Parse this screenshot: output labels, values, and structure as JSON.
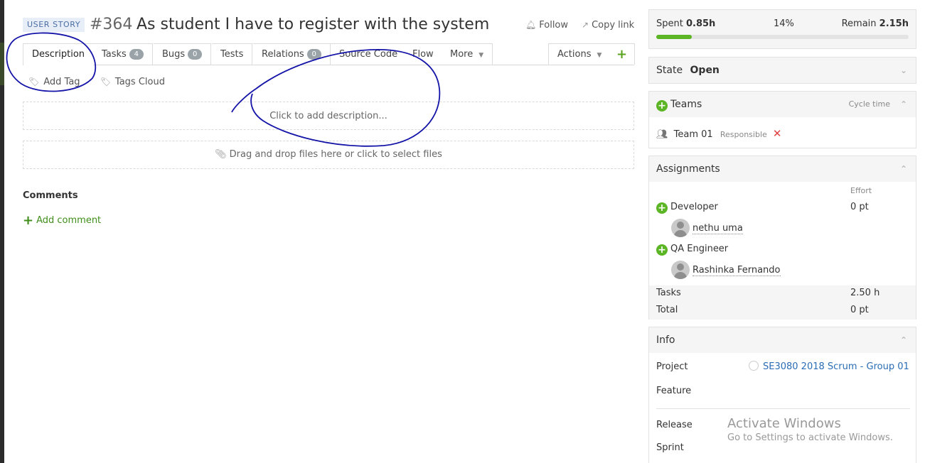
{
  "header": {
    "badge": "USER STORY",
    "id": "#364",
    "title": "As student I have to register with the system",
    "follow": "Follow",
    "copy_link": "Copy link"
  },
  "tabs": {
    "description": "Description",
    "tasks": "Tasks",
    "tasks_count": "4",
    "bugs": "Bugs",
    "bugs_count": "0",
    "tests": "Tests",
    "relations": "Relations",
    "relations_count": "0",
    "source_code": "Source Code",
    "flow": "Flow",
    "more": "More",
    "actions": "Actions",
    "add": "+"
  },
  "tags": {
    "add_tag": "Add Tag",
    "tags_cloud": "Tags Cloud"
  },
  "description_placeholder": "Click to add description...",
  "files_placeholder": "Drag and drop files here or click to select files",
  "comments": {
    "heading": "Comments",
    "add": "Add comment"
  },
  "progress": {
    "spent_label": "Spent",
    "spent_value": "0.85h",
    "percent_text": "14%",
    "percent": 0.14,
    "remain_label": "Remain",
    "remain_value": "2.15h"
  },
  "state": {
    "label": "State",
    "value": "Open"
  },
  "teams": {
    "title": "Teams",
    "cycle_time": "Cycle time",
    "team_name": "Team 01",
    "team_role": "Responsible"
  },
  "assignments": {
    "title": "Assignments",
    "effort_header": "Effort",
    "developer_role": "Developer",
    "developer_effort": "0 pt",
    "developer_user": "nethu uma",
    "qa_role": "QA Engineer",
    "qa_user": "Rashinka Fernando",
    "tasks_label": "Tasks",
    "tasks_value": "2.50 h",
    "total_label": "Total",
    "total_value": "0 pt"
  },
  "info": {
    "title": "Info",
    "project_label": "Project",
    "project_value": "SE3080 2018 Scrum - Group 01",
    "feature_label": "Feature",
    "release_label": "Release",
    "sprint_label": "Sprint"
  },
  "watermark": {
    "line1": "Activate Windows",
    "line2": "Go to Settings to activate Windows."
  },
  "colors": {
    "accent_green": "#5bb524",
    "link_blue": "#2a6db5",
    "ink_annotation": "#1414a8"
  }
}
